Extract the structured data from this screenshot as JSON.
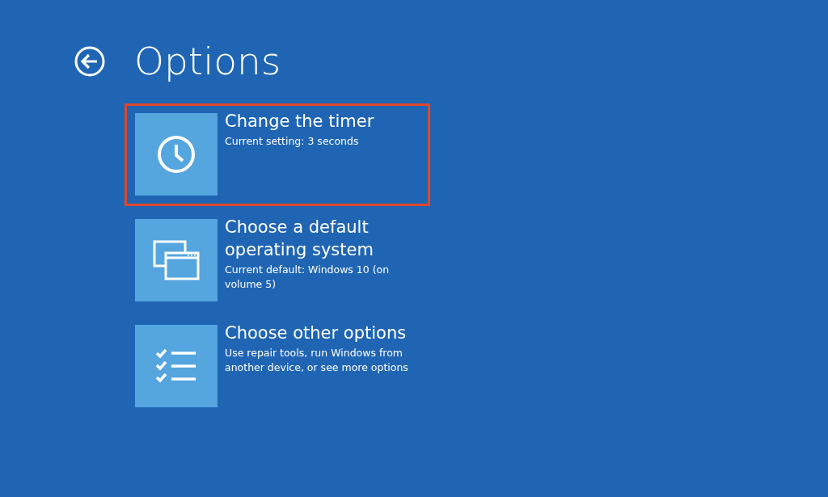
{
  "page": {
    "title": "Options"
  },
  "options": [
    {
      "kind": "timer",
      "heading": "Change the timer",
      "description": "Current setting: 3 seconds",
      "highlighted": true
    },
    {
      "kind": "os",
      "heading": "Choose a default operating system",
      "description": "Current default: Windows 10 (on volume 5)",
      "highlighted": false
    },
    {
      "kind": "checklist",
      "heading": "Choose other options",
      "description": "Use repair tools, run Windows from another device, or see more options",
      "highlighted": false
    }
  ]
}
